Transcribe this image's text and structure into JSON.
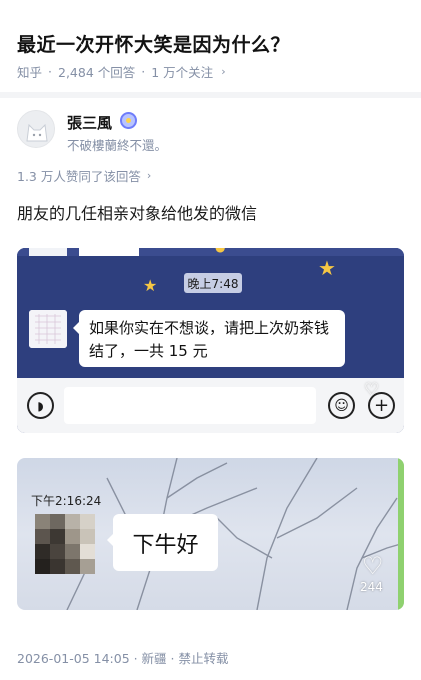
{
  "question": {
    "title": "最近一次开怀大笑是因为什么？",
    "source": "知乎",
    "answers": "2,484 个回答",
    "followers": "1 万个关注",
    "separator": "·",
    "chevron": "›"
  },
  "author": {
    "name": "張三風",
    "bio": "不破樓蘭終不還。",
    "avatar_icon": "cat-avatar-icon",
    "badge_icon": "verified-badge-icon"
  },
  "answer": {
    "votes": "1.3 万人赞同了该回答",
    "chevron": "›",
    "text": "朋友的几任相亲对象给他发的微信"
  },
  "screenshot1": {
    "time": "晚上7:48",
    "message": "如果你实在不想谈，请把上次奶茶钱结了，一共 15 元",
    "background_color": "#2e3f7e",
    "icons": [
      "voice-icon",
      "emoji-icon",
      "plus-icon",
      "heart-icon"
    ]
  },
  "screenshot2": {
    "time": "下午2:16:24",
    "message": "下牛好",
    "like_count": "244",
    "heart_icon": "heart-icon"
  },
  "footer": {
    "text": "2026-01-05 14:05 · 新疆 · 禁止转载"
  }
}
